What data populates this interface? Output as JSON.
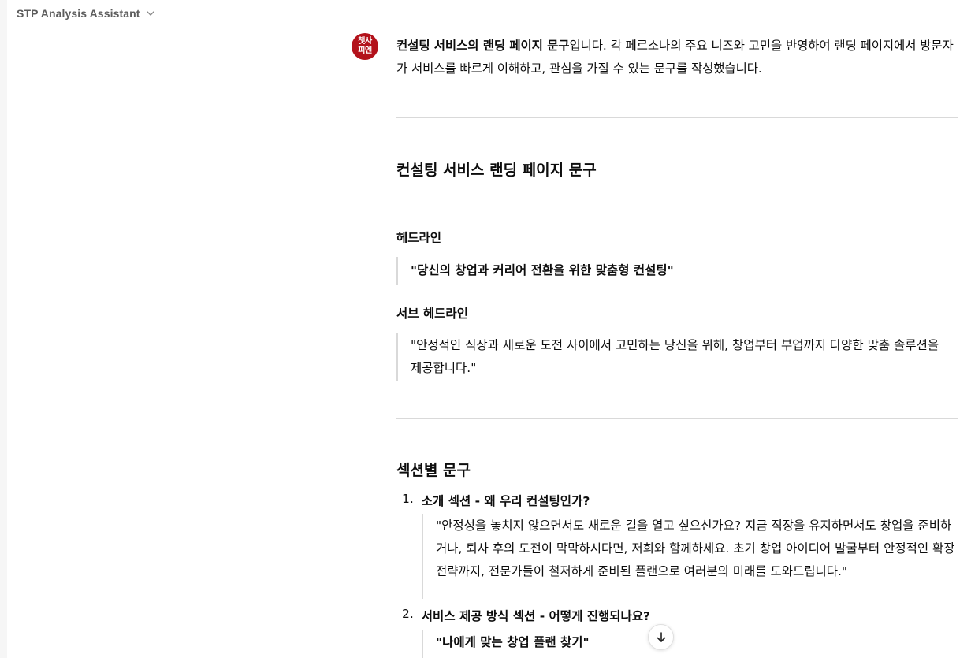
{
  "header": {
    "title": "STP Analysis Assistant"
  },
  "assistant": {
    "avatar_line1": "챗사",
    "avatar_line2": "피엔"
  },
  "message": {
    "intro_bold": "컨설팅 서비스의 랜딩 페이지 문구",
    "intro_rest": "입니다. 각 페르소나의 주요 니즈와 고민을 반영하여 랜딩 페이지에서 방문자가 서비스를 빠르게 이해하고, 관심을 가질 수 있는 문구를 작성했습니다.",
    "section1_title": "컨설팅 서비스 랜딩 페이지 문구",
    "headline_label": "헤드라인",
    "headline_quote": "\"당신의 창업과 커리어 전환을 위한 맞춤형 컨설팅\"",
    "subheadline_label": "서브 헤드라인",
    "subheadline_quote": "\"안정적인 직장과 새로운 도전 사이에서 고민하는 당신을 위해, 창업부터 부업까지 다양한 맞춤 솔루션을 제공합니다.\"",
    "section2_title": "섹션별 문구",
    "items": [
      {
        "number": "1.",
        "title": "소개 섹션 - 왜 우리 컨설팅인가?",
        "quote": "\"안정성을 놓치지 않으면서도 새로운 길을 열고 싶으신가요? 지금 직장을 유지하면서도 창업을 준비하거나, 퇴사 후의 도전이 막막하시다면, 저희와 함께하세요. 초기 창업 아이디어 발굴부터 안정적인 확장 전략까지, 전문가들이 철저하게 준비된 플랜으로 여러분의 미래를 도와드립니다.\""
      },
      {
        "number": "2.",
        "title": "서비스 제공 방식 섹션 - 어떻게 진행되나요?",
        "quote": "\"나에게 맞는 창업 플랜 찾기\""
      }
    ]
  },
  "icons": {
    "chevron": "chevron-down-icon",
    "scroll": "arrow-down-icon"
  }
}
